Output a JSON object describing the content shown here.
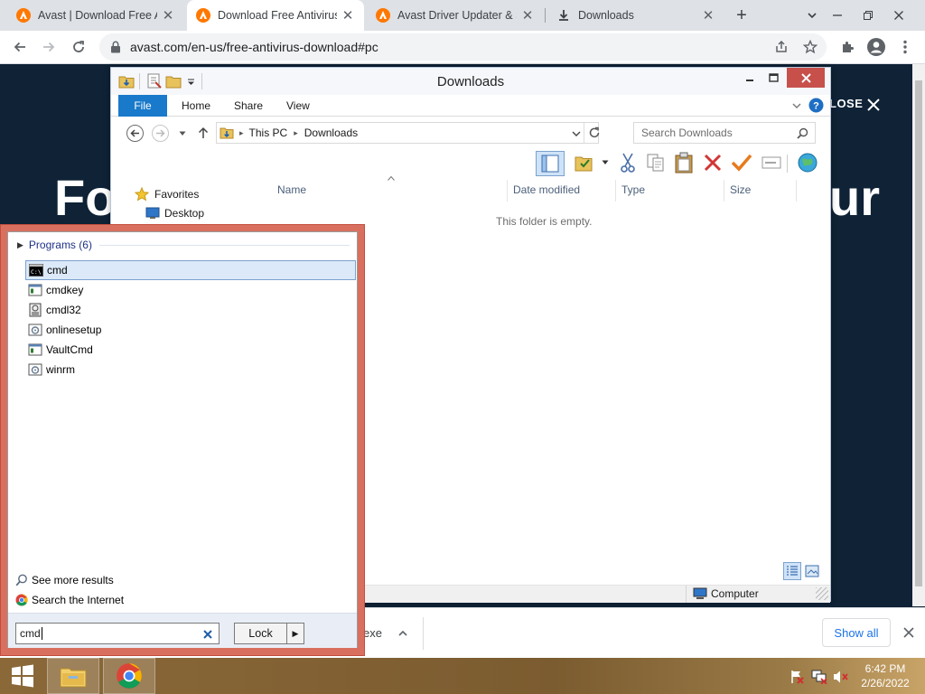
{
  "browser": {
    "tabs": [
      {
        "title": "Avast | Download Free Ar",
        "icon": "avast-icon",
        "active": false
      },
      {
        "title": "Download Free Antivirus",
        "icon": "avast-icon",
        "active": true
      },
      {
        "title": "Avast Driver Updater & S",
        "icon": "avast-icon",
        "active": false
      },
      {
        "title": "Downloads",
        "icon": "download-icon",
        "active": false
      }
    ],
    "close_glyph": "✕",
    "new_tab_glyph": "+",
    "url": "avast.com/en-us/free-antivirus-download#pc"
  },
  "site": {
    "hero_left": "Fo",
    "hero_right": "ur",
    "close_label": "LOSE"
  },
  "download_bar": {
    "item_fragment": "exe",
    "show_all": "Show all"
  },
  "explorer": {
    "title": "Downloads",
    "ribbon_tabs": [
      "File",
      "Home",
      "Share",
      "View"
    ],
    "breadcrumb": [
      "This PC",
      "Downloads"
    ],
    "search_placeholder": "Search Downloads",
    "columns": [
      "Name",
      "Date modified",
      "Type",
      "Size"
    ],
    "empty_message": "This folder is empty.",
    "nav": {
      "favorites": "Favorites",
      "desktop": "Desktop"
    },
    "status_location": "Computer"
  },
  "start_search": {
    "group_label": "Programs (6)",
    "programs": [
      {
        "name": "cmd",
        "icon": "console-icon",
        "selected": true
      },
      {
        "name": "cmdkey",
        "icon": "app-window-icon",
        "selected": false
      },
      {
        "name": "cmdl32",
        "icon": "dialer-icon",
        "selected": false
      },
      {
        "name": "onlinesetup",
        "icon": "setup-icon",
        "selected": false
      },
      {
        "name": "VaultCmd",
        "icon": "app-window-icon",
        "selected": false
      },
      {
        "name": "winrm",
        "icon": "setup-icon",
        "selected": false
      }
    ],
    "see_more": "See more results",
    "search_internet": "Search the Internet",
    "query": "cmd",
    "lock_label": "Lock"
  },
  "taskbar": {
    "time": "6:42 PM",
    "date": "2/26/2022"
  },
  "colors": {
    "chrome_accent": "#1a73e8",
    "avast_orange": "#ff7800",
    "ribbon_file_blue": "#1979ca",
    "explorer_close_red": "#c7504b",
    "start_border_red": "#d9705f"
  }
}
